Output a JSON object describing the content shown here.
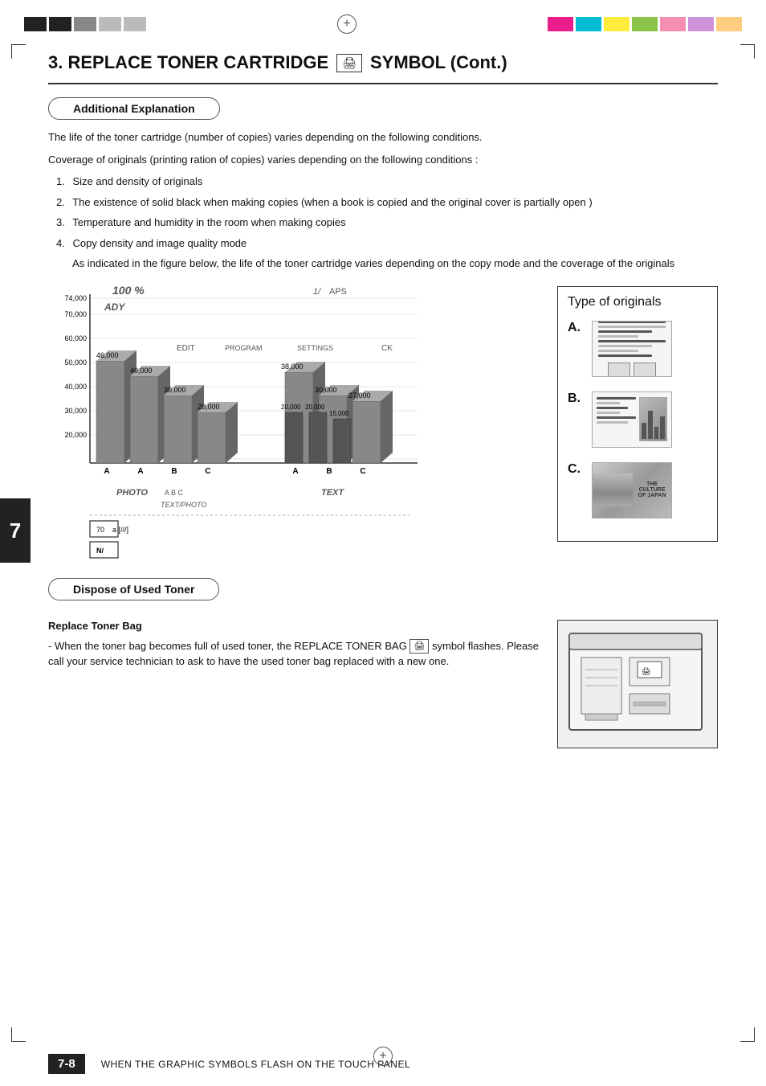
{
  "page": {
    "title": "3. REPLACE TONER CARTRIDGE",
    "title_icon": "🖨",
    "title_suffix": "SYMBOL (Cont.)",
    "section1_label": "Additional Explanation",
    "section1_text1": "The life of the toner cartridge (number of copies) varies depending on the following conditions.",
    "section1_text2": "Coverage of originals (printing ration of copies) varies depending on the following conditions :",
    "list_items": [
      {
        "num": "1.",
        "text": "Size and density of originals"
      },
      {
        "num": "2.",
        "text": "The existence of solid black when making copies (when a book is copied and the original cover is partially open )"
      },
      {
        "num": "3.",
        "text": "Temperature and humidity in the room when making copies"
      },
      {
        "num": "4.",
        "text": "Copy density and image quality mode"
      }
    ],
    "list_item4_indent": "As indicated in the figure below, the life of the toner cartridge varies depending on the copy mode and the coverage of the originals",
    "chart_y_labels": [
      "74,000",
      "70,000",
      "60,000",
      "50,000",
      "40,000",
      "30,000",
      "20,000"
    ],
    "chart_data_labels": [
      "46,000",
      "40,000",
      "30,000",
      "20,000",
      "38,000",
      "30,000",
      "20,000",
      "27,000",
      "20,000",
      "15,000"
    ],
    "chart_x_labels": [
      "A",
      "B",
      "C"
    ],
    "chart_modes": [
      "ADY",
      "EDIT",
      "PROGRAM",
      "SETTINGS",
      "CK",
      "PHOTO",
      "TEXT",
      "TEXT/PHOTO"
    ],
    "legend_title": "Type of originals",
    "legend_items": [
      {
        "label": "A.",
        "type": "text_document"
      },
      {
        "label": "B.",
        "type": "text_with_image"
      },
      {
        "label": "C.",
        "type": "photo"
      }
    ],
    "section2_label": "Dispose of Used Toner",
    "replace_bag_title": "Replace Toner Bag",
    "replace_bag_text": "- When the toner bag becomes full of used toner, the REPLACE TONER BAG",
    "replace_bag_symbol": "🖨",
    "replace_bag_text2": "symbol flashes. Please call your service technician to ask to have the used toner bag replaced with a new one.",
    "page_number": "7-8",
    "footer_text": "WHEN THE GRAPHIC SYMBOLS FLASH ON THE TOUCH PANEL",
    "side_tab_number": "7",
    "colors": {
      "black_swatch": "#111",
      "dark_gray": "#444",
      "mid_gray": "#888",
      "light_gray": "#bbb",
      "cyan": "#00bcd4",
      "magenta": "#e91e8c",
      "yellow": "#ffeb3b",
      "green": "#8bc34a",
      "pink": "#f48fb1",
      "lavender": "#ce93d8",
      "peach": "#ffcc80"
    }
  }
}
